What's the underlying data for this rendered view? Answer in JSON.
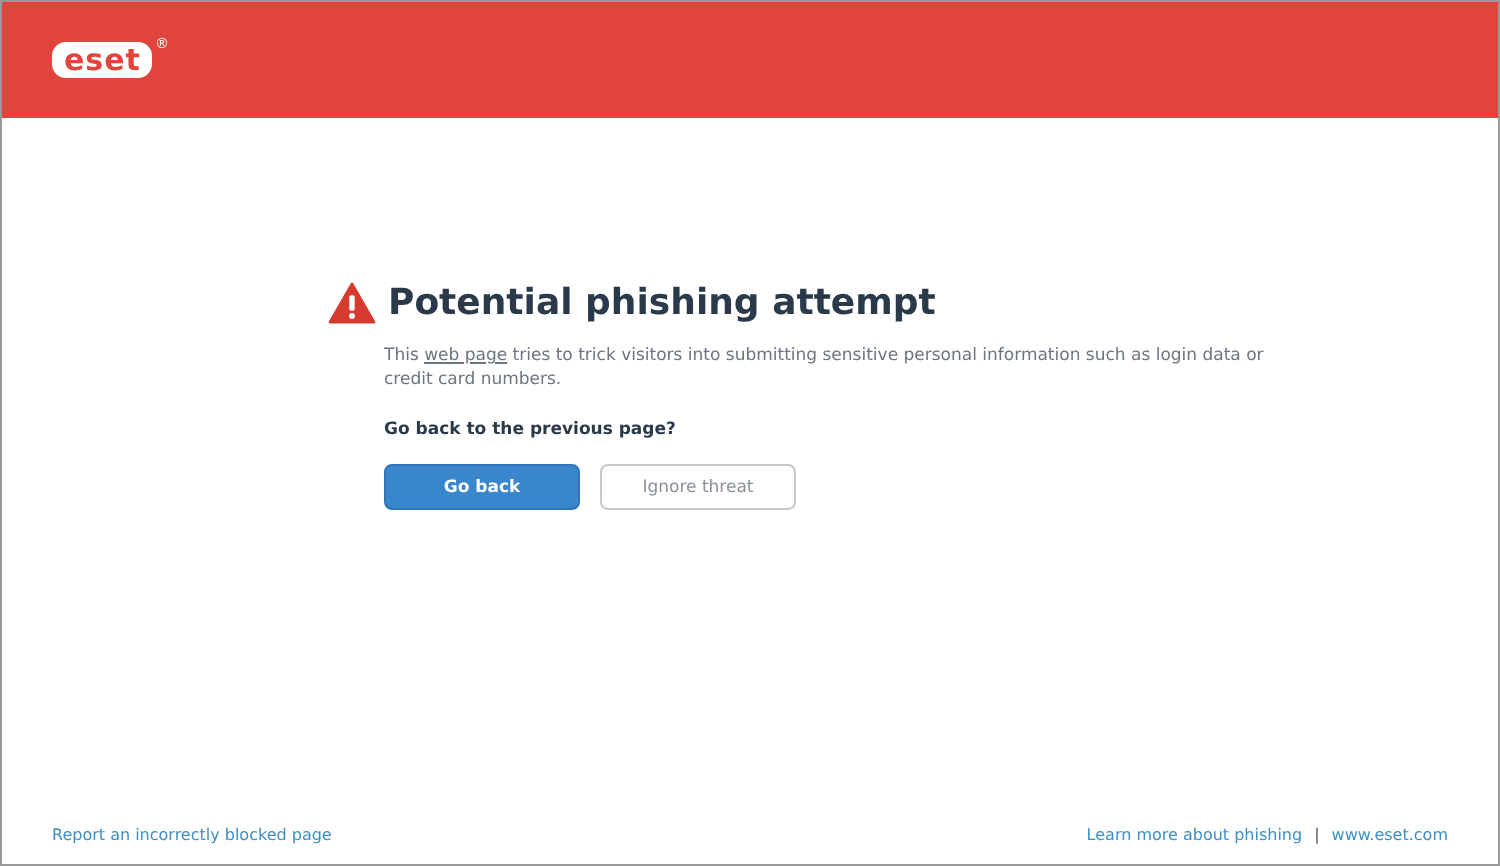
{
  "header": {
    "logo": "eset",
    "logo_mark": "®"
  },
  "warning": {
    "title": "Potential phishing attempt",
    "description": {
      "before": "This ",
      "link": "web page",
      "after": " tries to trick visitors into submitting sensitive personal information such as login data or credit card numbers."
    },
    "question": "Go back to the previous page?",
    "buttons": [
      {
        "label": "Go back",
        "kind": "primary"
      },
      {
        "label": "Ignore threat",
        "kind": "secondary"
      }
    ]
  },
  "footer": {
    "left_link": "Report an incorrectly blocked page",
    "right_links": [
      "Learn more about phishing",
      "www.eset.com"
    ],
    "separator": "|"
  }
}
